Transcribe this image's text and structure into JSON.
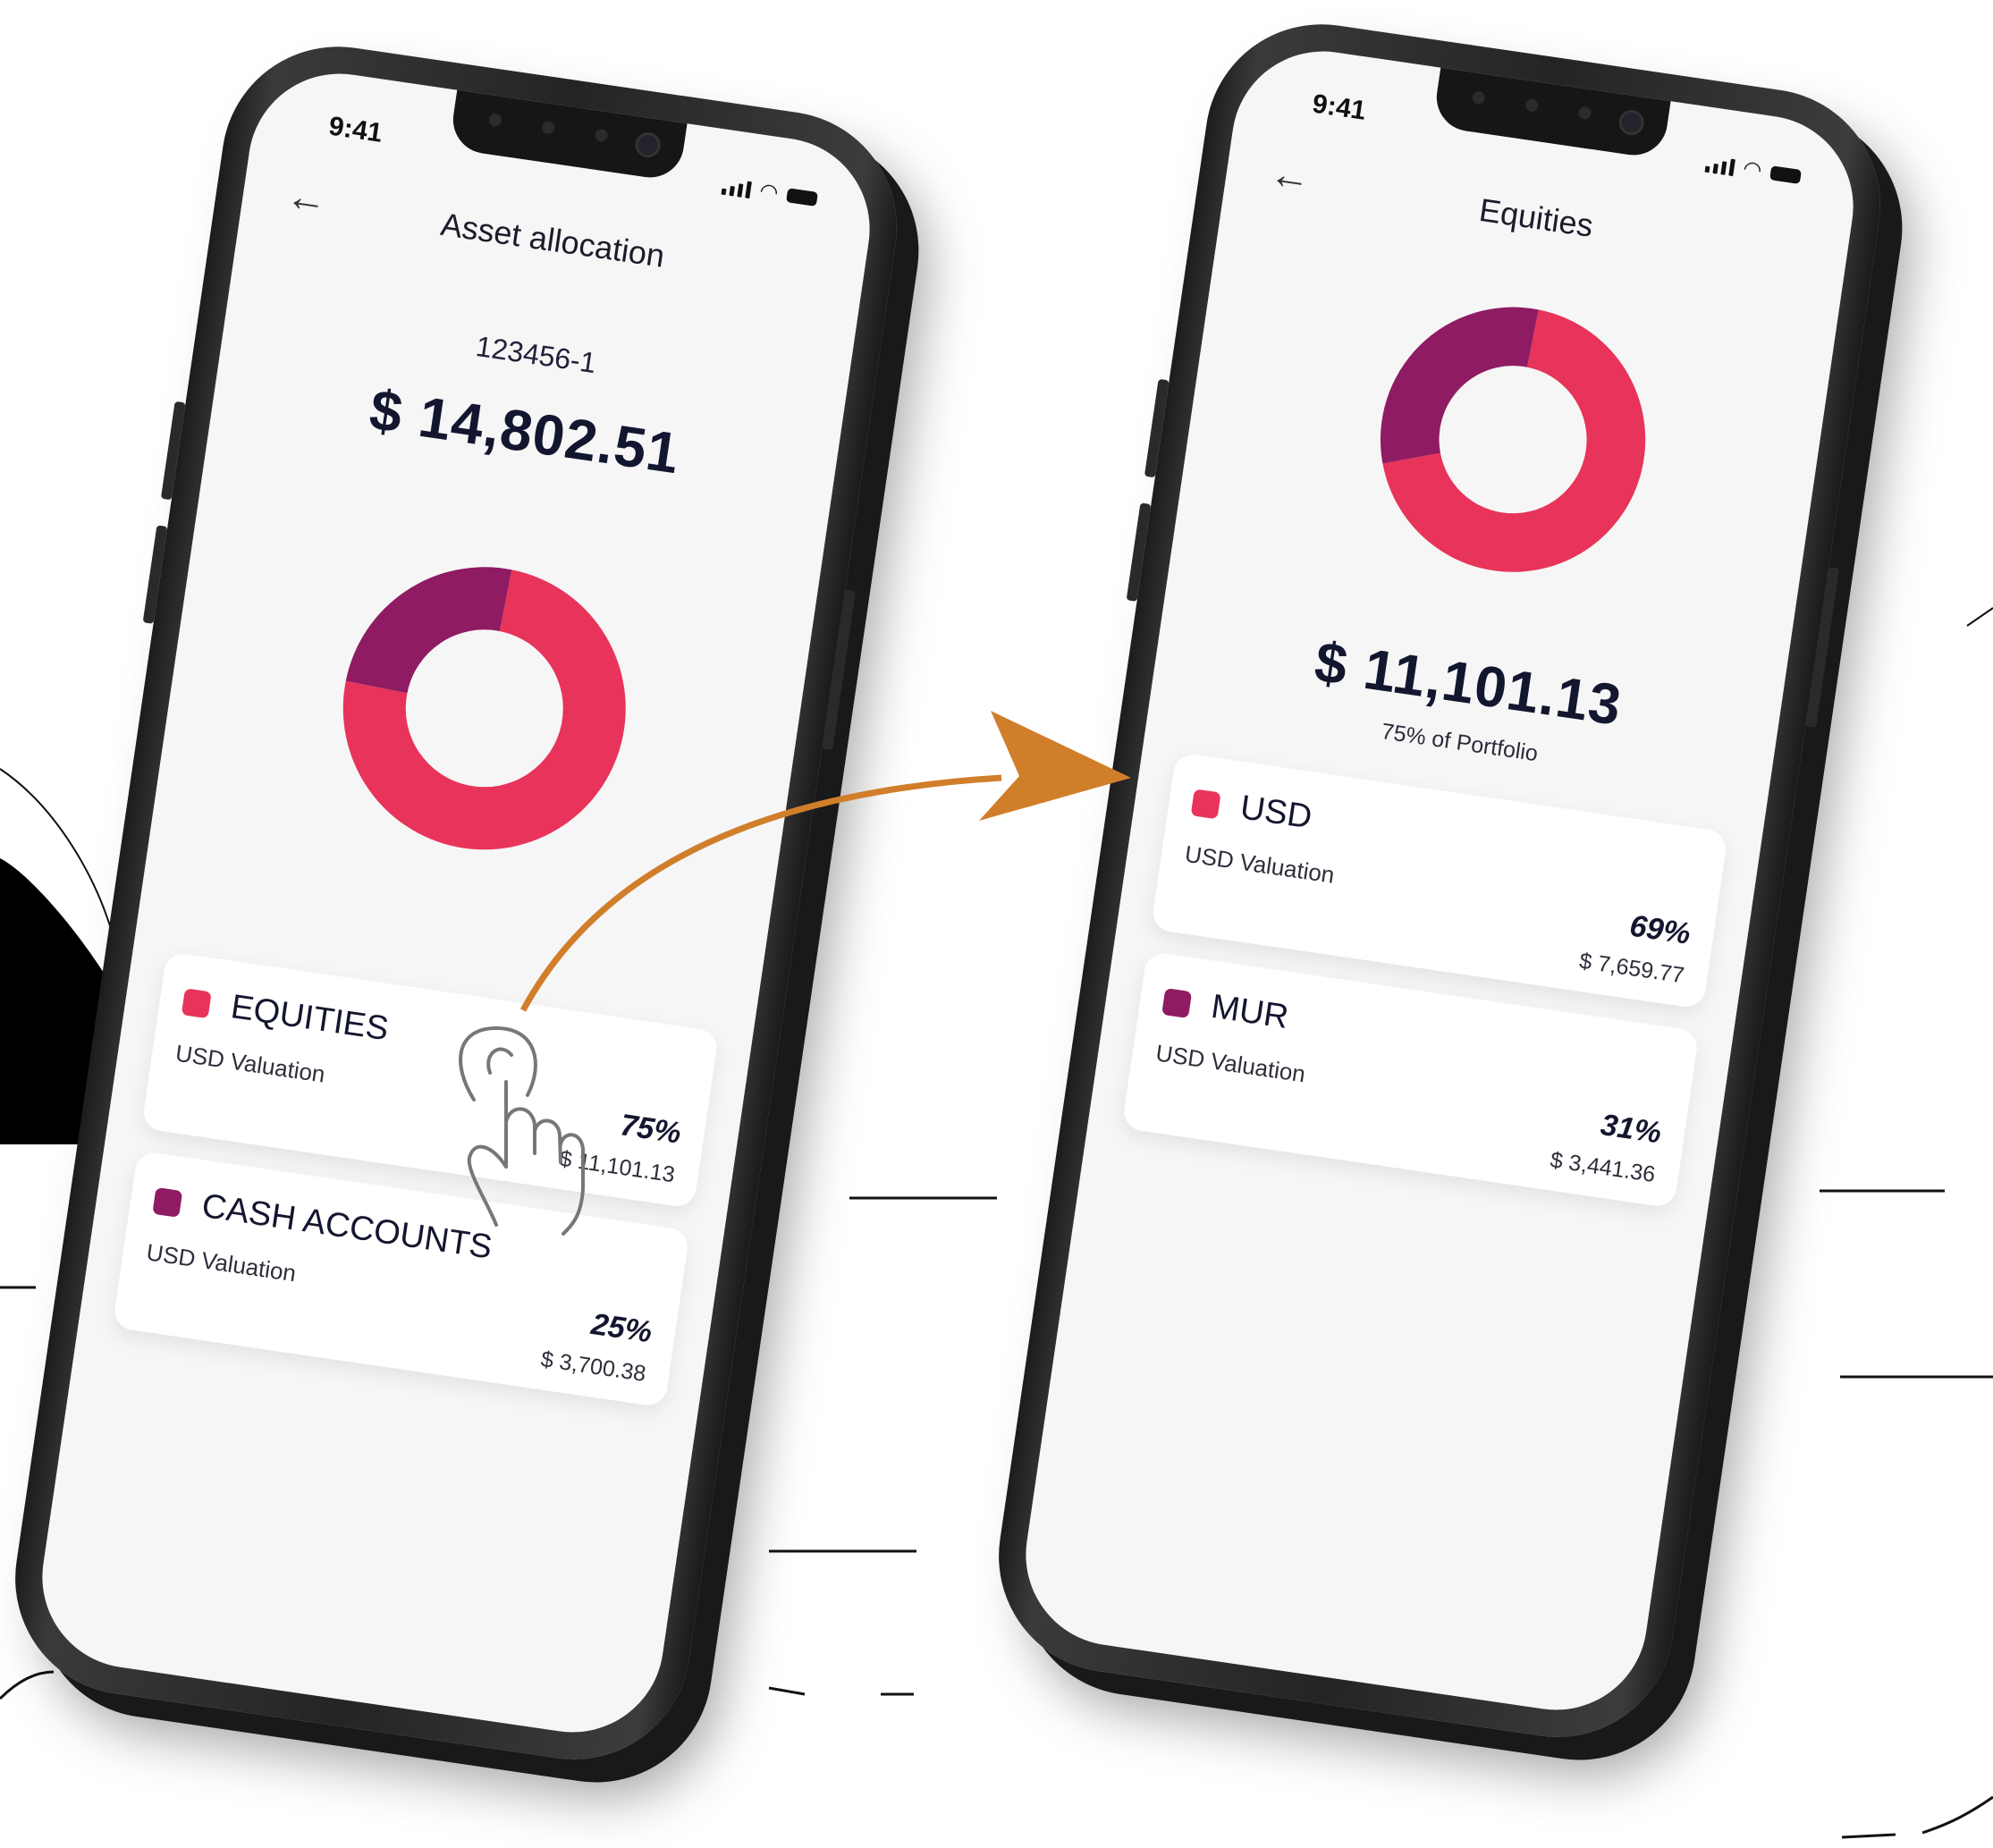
{
  "colors": {
    "equities": "#e8345a",
    "cash": "#8f1b63",
    "arrow": "#d17e2b",
    "navy": "#13162f"
  },
  "status_bar": {
    "time": "9:41"
  },
  "screen1": {
    "back_icon": "arrow-left-icon",
    "title": "Asset allocation",
    "account_number": "123456-1",
    "total": "$ 14,802.51",
    "items": [
      {
        "name": "EQUITIES",
        "valuation_label": "USD Valuation",
        "percent": "75%",
        "amount": "$ 11,101.13",
        "color": "#e8345a"
      },
      {
        "name": "CASH ACCOUNTS",
        "valuation_label": "USD Valuation",
        "percent": "25%",
        "amount": "$ 3,700.38",
        "color": "#8f1b63"
      }
    ]
  },
  "screen2": {
    "back_icon": "arrow-left-icon",
    "title": "Equities",
    "total": "$ 11,101.13",
    "subtitle": "75% of Portfolio",
    "items": [
      {
        "name": "USD",
        "valuation_label": "USD Valuation",
        "percent": "69%",
        "amount": "$ 7,659.77",
        "color": "#e8345a"
      },
      {
        "name": "MUR",
        "valuation_label": "USD Valuation",
        "percent": "31%",
        "amount": "$ 3,441.36",
        "color": "#8f1b63"
      }
    ]
  },
  "chart_data": [
    {
      "type": "pie",
      "categories": [
        "EQUITIES",
        "CASH ACCOUNTS"
      ],
      "values": [
        75,
        25
      ],
      "colors": [
        "#e8345a",
        "#8f1b63"
      ],
      "style": "donut"
    },
    {
      "type": "pie",
      "categories": [
        "USD",
        "MUR"
      ],
      "values": [
        69,
        31
      ],
      "colors": [
        "#e8345a",
        "#8f1b63"
      ],
      "style": "donut"
    }
  ],
  "gesture_icon": "tap-hand-icon"
}
